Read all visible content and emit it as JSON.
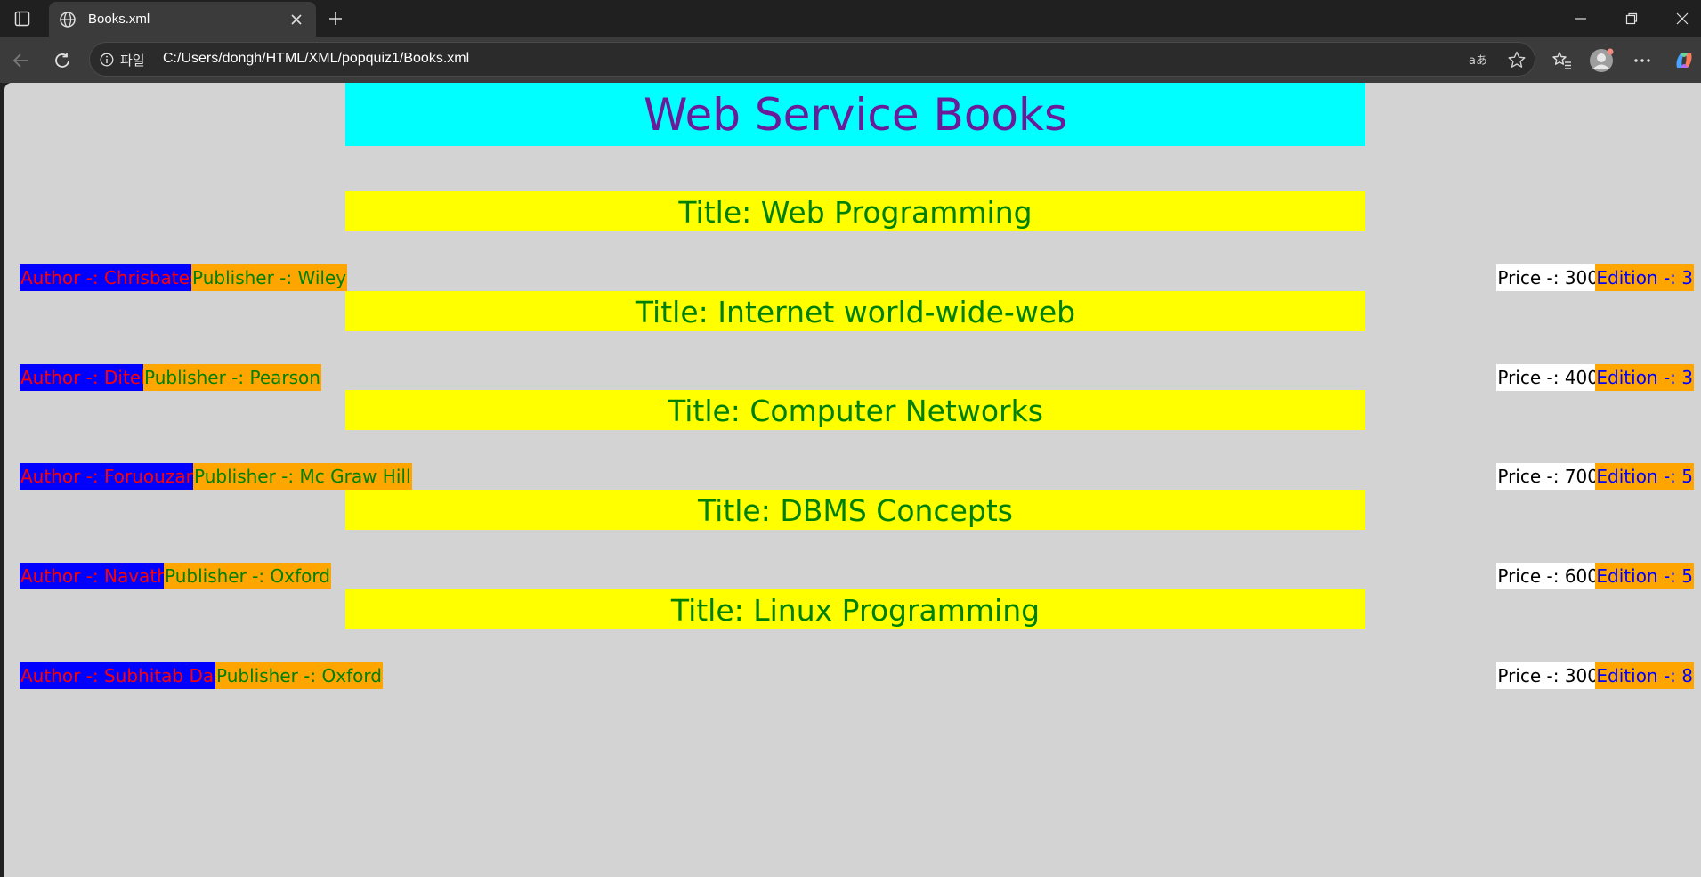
{
  "browser": {
    "tab_title": "Books.xml",
    "address_prefix": "파일",
    "url": "C:/Users/dongh/HTML/XML/popquiz1/Books.xml"
  },
  "page": {
    "header": "Web Service Books",
    "books": [
      {
        "title": "Title: Web Programming",
        "author": "Author -: Chrisbates",
        "publisher": "Publisher -: Wiley",
        "price": "Price -: 300",
        "edition": "Edition -: 3"
      },
      {
        "title": "Title: Internet world-wide-web",
        "author": "Author -: Ditel",
        "publisher": "Publisher -: Pearson",
        "price": "Price -: 400",
        "edition": "Edition -: 3"
      },
      {
        "title": "Title: Computer Networks",
        "author": "Author -: Foruouzan",
        "publisher": "Publisher -: Mc Graw Hill",
        "price": "Price -: 700",
        "edition": "Edition -: 5"
      },
      {
        "title": "Title: DBMS Concepts",
        "author": "Author -: Navath",
        "publisher": "Publisher -: Oxford",
        "price": "Price -: 600",
        "edition": "Edition -: 5"
      },
      {
        "title": "Title: Linux Programming",
        "author": "Author -: Subhitab Das",
        "publisher": "Publisher -: Oxford",
        "price": "Price -: 300",
        "edition": "Edition -: 8"
      }
    ]
  },
  "colors": {
    "header_bg": "#00ffff",
    "header_text": "#6a1b9a",
    "title_bg": "#ffff00",
    "title_text": "#008000",
    "author_bg": "#0000ff",
    "author_text": "#ff0000",
    "publisher_bg": "#ffa500",
    "publisher_text": "#008000",
    "price_bg": "#ffffff",
    "edition_text": "#0000ff",
    "page_bg": "#d3d3d3"
  }
}
